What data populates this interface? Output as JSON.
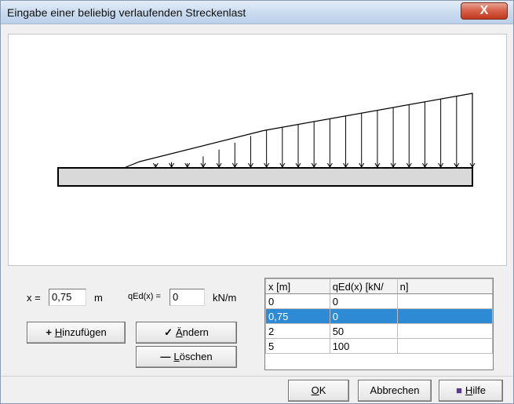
{
  "window": {
    "title": "Eingabe einer beliebig verlaufenden Streckenlast",
    "close_label": "X"
  },
  "inputs": {
    "x_label": "x =",
    "x_value": "0,75",
    "x_unit": "m",
    "q_label": "qEd(x) =",
    "q_value": "0",
    "q_unit": "kN/m"
  },
  "buttons": {
    "add": {
      "icon": "+",
      "mnemonic": "H",
      "rest": "inzufügen"
    },
    "change": {
      "icon": "✓",
      "mnemonic": "Ä",
      "rest": "ndern"
    },
    "delete": {
      "icon": "—",
      "mnemonic": "L",
      "rest": "öschen"
    }
  },
  "table": {
    "headers": [
      "x [m]",
      "qEd(x) [kN/",
      "n]"
    ],
    "rows": [
      {
        "x": "0",
        "q": "0",
        "selected": false
      },
      {
        "x": "0,75",
        "q": "0",
        "selected": true
      },
      {
        "x": "2",
        "q": "50",
        "selected": false
      },
      {
        "x": "5",
        "q": "100",
        "selected": false
      }
    ]
  },
  "footer": {
    "ok": {
      "mnemonic": "O",
      "rest": "K"
    },
    "cancel": {
      "label": "Abbrechen"
    },
    "help": {
      "icon": "book-icon",
      "mnemonic": "H",
      "rest": "ilfe"
    }
  },
  "load_diagram": {
    "points": [
      [
        0,
        0
      ],
      [
        0.75,
        0
      ],
      [
        2,
        50
      ],
      [
        5,
        100
      ]
    ],
    "x_max": 5,
    "q_max": 100
  }
}
